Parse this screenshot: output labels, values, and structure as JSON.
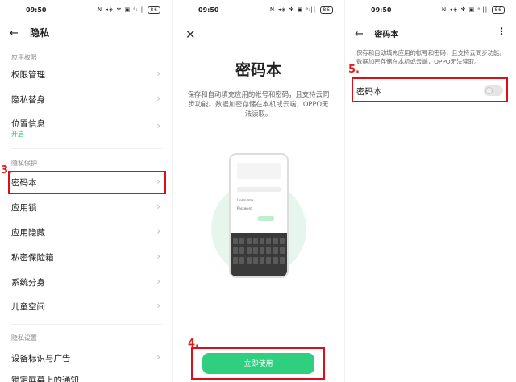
{
  "panel1": {
    "status": {
      "time": "09:50",
      "icons": "N ◂◈ ✻ ▣ ᵃᵢ|| ",
      "battery": "86"
    },
    "header": {
      "back_icon": "←",
      "title": "隐私"
    },
    "sections": [
      {
        "title": "应用权限"
      },
      {
        "title": "隐私保护"
      },
      {
        "title": "隐私设置"
      }
    ],
    "items": [
      {
        "label": "权限管理"
      },
      {
        "label": "隐私替身"
      },
      {
        "label": "位置信息",
        "sub": "开启"
      },
      {
        "label": "密码本"
      },
      {
        "label": "应用锁"
      },
      {
        "label": "应用隐藏"
      },
      {
        "label": "私密保险箱"
      },
      {
        "label": "系统分身"
      },
      {
        "label": "儿童空间"
      },
      {
        "label": "设备标识与广告"
      },
      {
        "label": "锁定屏幕上的通知"
      }
    ],
    "annotation": "3."
  },
  "panel2": {
    "status": {
      "time": "09:50",
      "icons": "N ◂◈ ✻ ▣ ᵃᵢ|| ",
      "battery": "86"
    },
    "close_icon": "✕",
    "title": "密码本",
    "description": "保存和自动填充应用的帐号和密码，且支持云同步功能。数据加密存储在本机或云端，OPPO无法读取。",
    "illustration": {
      "field1": "Username",
      "field2": "Password"
    },
    "button": "立即使用",
    "annotation": "4."
  },
  "panel3": {
    "status": {
      "time": "09:50",
      "icons": "N ◂◈ ✻ ▣ ᵃᵢ|| ",
      "battery": "86"
    },
    "header": {
      "back_icon": "←",
      "title": "密码本",
      "more_icon": "⋮"
    },
    "description": "保存和自动填充应用的帐号和密码，且支持云同步功能。数据加密存储在本机或云端，OPPO无法读取。",
    "toggle_label": "密码本",
    "toggle_on": false,
    "annotation": "5."
  }
}
